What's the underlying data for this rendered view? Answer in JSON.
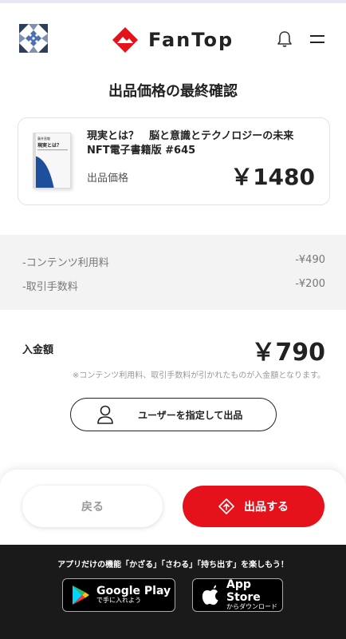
{
  "header": {
    "logo_text": "FanTop",
    "avatar_icon": "pattern-avatar-icon",
    "bell_icon": "bell-icon",
    "menu_icon": "menu-icon"
  },
  "page_title": "出品価格の最終確認",
  "product": {
    "name": "現実とは？　脳と意識とテクノロジーの未来 NFT電子書籍版 #645",
    "price_label": "出品価格",
    "price": "￥1480",
    "cover_title": "現実とは？",
    "cover_author": "藤井直敬"
  },
  "fees": [
    {
      "label": "-コンテンツ利用料",
      "value": "-¥490"
    },
    {
      "label": "-取引手数料",
      "value": "-¥200"
    }
  ],
  "net": {
    "label": "入金額",
    "value": "￥790",
    "note": "※コンテンツ利用料、取引手数料が引かれたものが入金額となります。"
  },
  "user_button": {
    "label": "ユーザーを指定して出品",
    "icon": "person-icon"
  },
  "actions": {
    "back_label": "戻る",
    "list_label": "出品する",
    "list_icon": "upload-arrow-icon"
  },
  "promo": {
    "text": "アプリだけの機能「かざる」「さわる」「持ち出す」を楽しもう！",
    "google": {
      "big": "Google Play",
      "small": "で手に入れよう"
    },
    "apple": {
      "big": "App Store",
      "small": "からダウンロード"
    }
  },
  "colors": {
    "accent": "#e5121c",
    "footer": "#1a1a1a",
    "fee_bg": "#f3f3f3"
  }
}
